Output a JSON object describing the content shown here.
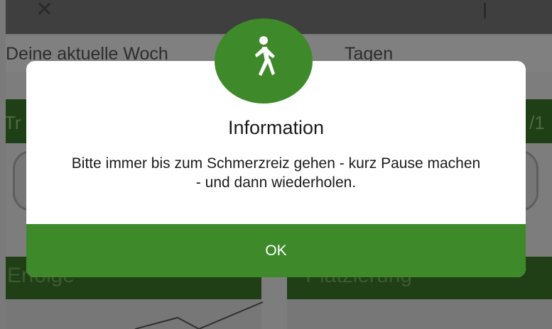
{
  "background": {
    "week_text_left": "Deine aktuelle Woch",
    "week_text_right": "Tagen",
    "green_bar_left": "Tr",
    "green_bar_right": "/1",
    "tile_left_label": "Erfolge",
    "tile_right_label": "Platzierung"
  },
  "dialog": {
    "icon": "walking-person-icon",
    "title": "Information",
    "message": "Bitte immer bis zum Schmerzreiz gehen - kurz Pause machen - und dann wiederholen.",
    "ok_label": "OK"
  },
  "colors": {
    "accent_green": "#3e8a2a",
    "dialog_background": "#ffffff"
  }
}
